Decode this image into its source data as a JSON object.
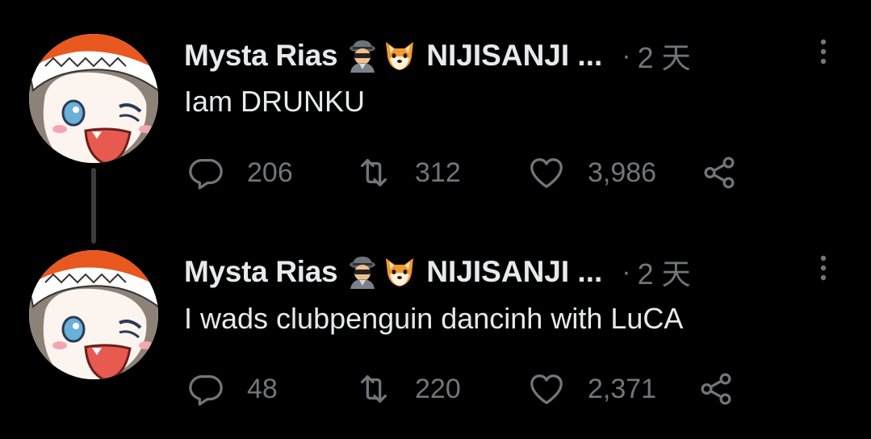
{
  "tweets": [
    {
      "display_name": "Mysta Rias",
      "emojis": [
        "detective-emoji",
        "fox-emoji"
      ],
      "handle": "NIJISANJI ...",
      "separator": "·",
      "time": "2 天",
      "text": "Iam DRUNKU",
      "reply_count": "206",
      "retweet_count": "312",
      "like_count": "3,986"
    },
    {
      "display_name": "Mysta Rias",
      "emojis": [
        "detective-emoji",
        "fox-emoji"
      ],
      "handle": "NIJISANJI ...",
      "separator": "·",
      "time": "2 天",
      "text": "I wads clubpenguin dancinh with LuCA",
      "reply_count": "48",
      "retweet_count": "220",
      "like_count": "2,371"
    }
  ],
  "icons": {
    "reply": "reply-icon",
    "retweet": "retweet-icon",
    "like": "heart-icon",
    "share": "share-icon",
    "more": "more-vertical-icon"
  },
  "colors": {
    "background": "#000000",
    "primary_text": "#e7e9ea",
    "secondary_text": "#71767b",
    "thread_line": "#3a3d40"
  }
}
